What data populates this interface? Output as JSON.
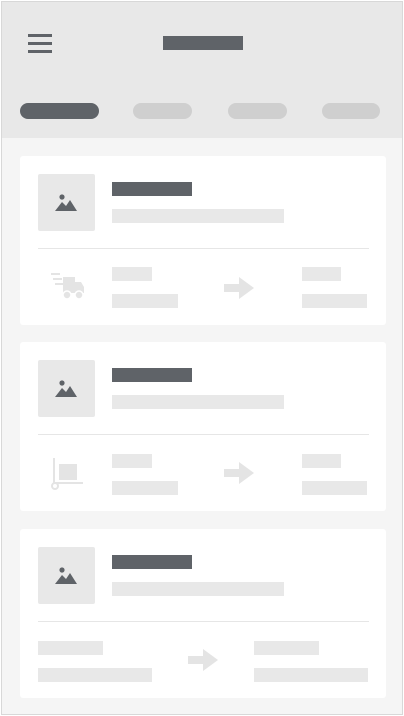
{
  "screen": {
    "type": "wireframe-shipment-list",
    "colors": {
      "background": "#f5f5f5",
      "header": "#e8e8e8",
      "placeholder_dark": "#5f6368",
      "placeholder_light": "#e8e8e8",
      "tab_inactive": "#cfcfcf",
      "card": "#ffffff"
    }
  },
  "header": {
    "menu_icon": "hamburger-menu-icon",
    "tabs": [
      {
        "active": true
      },
      {
        "active": false
      },
      {
        "active": false
      },
      {
        "active": false
      }
    ]
  },
  "cards": [
    {
      "image_icon": "image-placeholder-icon",
      "vehicle_icon": "delivery-truck-icon",
      "route_icon": "arrow-right-icon"
    },
    {
      "image_icon": "image-placeholder-icon",
      "vehicle_icon": "hand-truck-icon",
      "route_icon": "arrow-right-icon"
    },
    {
      "image_icon": "image-placeholder-icon",
      "vehicle_icon": null,
      "route_icon": "arrow-right-icon"
    }
  ]
}
